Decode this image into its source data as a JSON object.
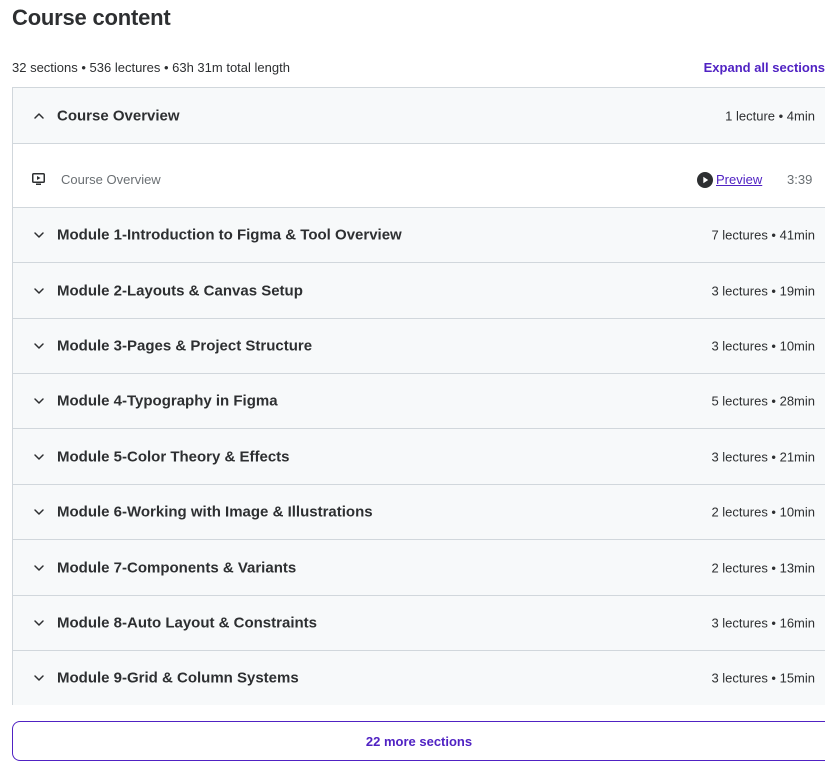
{
  "heading": "Course content",
  "summary": "32 sections • 536 lectures • 63h 31m total length",
  "expand_all_label": "Expand all sections",
  "colors": {
    "accent": "#5022c3",
    "header_bg": "#f7f9fa",
    "border": "#d1d7dc",
    "text": "#2d2f31",
    "muted": "#6a6f73"
  },
  "sections": [
    {
      "title": "Course Overview",
      "stats": "1 lecture • 4min",
      "icon": "chevron-up-icon",
      "expanded": true,
      "lectures": [
        {
          "title": "Course Overview",
          "icon": "video-icon",
          "preview_label": "Preview",
          "duration": "3:39"
        }
      ]
    },
    {
      "title": "Module 1-Introduction to Figma & Tool Overview",
      "stats": "7 lectures • 41min",
      "icon": "chevron-down-icon"
    },
    {
      "title": "Module 2-Layouts & Canvas Setup",
      "stats": "3 lectures • 19min",
      "icon": "chevron-down-icon"
    },
    {
      "title": "Module 3-Pages & Project Structure",
      "stats": "3 lectures • 10min",
      "icon": "chevron-down-icon"
    },
    {
      "title": "Module 4-Typography in Figma",
      "stats": "5 lectures • 28min",
      "icon": "chevron-down-icon"
    },
    {
      "title": "Module 5-Color Theory & Effects",
      "stats": "3 lectures • 21min",
      "icon": "chevron-down-icon"
    },
    {
      "title": "Module 6-Working with Image & Illustrations",
      "stats": "2 lectures • 10min",
      "icon": "chevron-down-icon"
    },
    {
      "title": "Module 7-Components & Variants",
      "stats": "2 lectures • 13min",
      "icon": "chevron-down-icon"
    },
    {
      "title": "Module 8-Auto Layout & Constraints",
      "stats": "3 lectures • 16min",
      "icon": "chevron-down-icon"
    },
    {
      "title": "Module 9-Grid & Column Systems",
      "stats": "3 lectures • 15min",
      "icon": "chevron-down-icon"
    }
  ],
  "more_sections_label": "22 more sections"
}
